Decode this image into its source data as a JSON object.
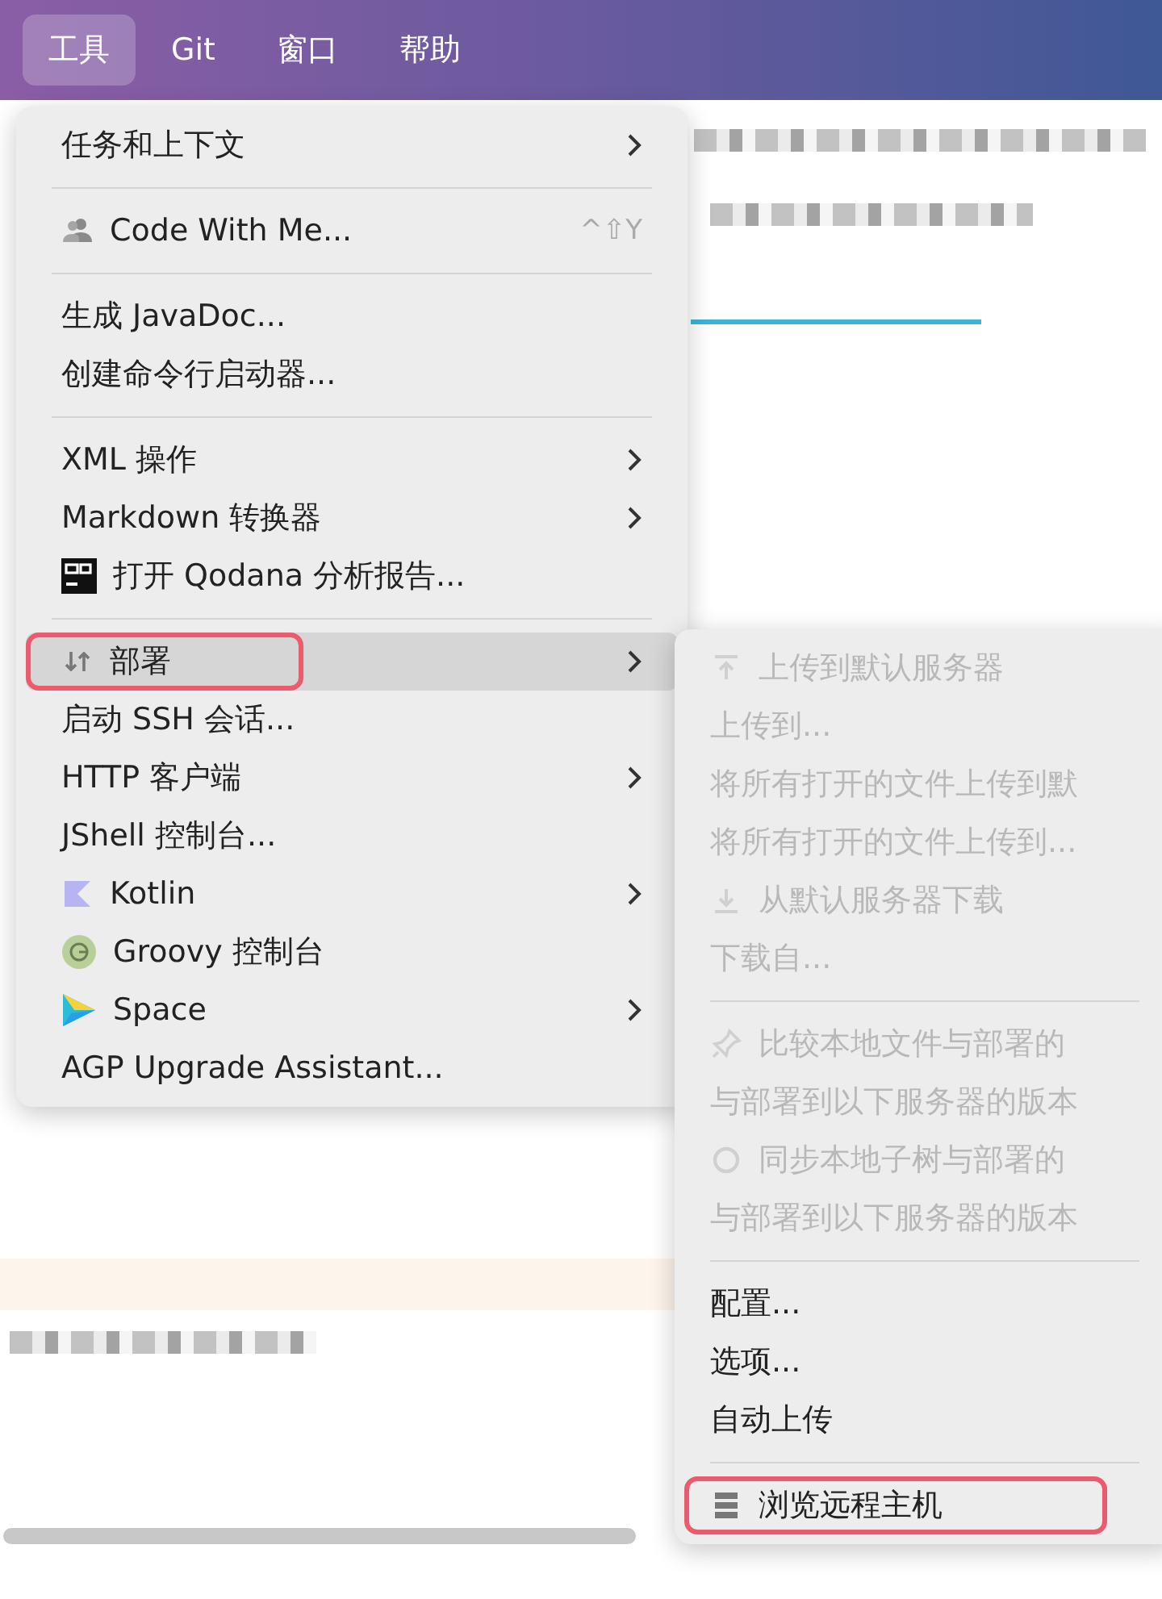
{
  "menubar": [
    {
      "label": "工具",
      "selected": true
    },
    {
      "label": "Git",
      "selected": false
    },
    {
      "label": "窗口",
      "selected": false
    },
    {
      "label": "帮助",
      "selected": false
    }
  ],
  "menu": {
    "items": [
      {
        "kind": "item",
        "label": "任务和上下文",
        "submenu": true,
        "selected": false,
        "highlighted": false
      },
      {
        "kind": "separator"
      },
      {
        "kind": "item",
        "label": "Code With Me...",
        "shortcut": "^⇧Y",
        "submenu": false,
        "selected": false,
        "highlighted": false
      },
      {
        "kind": "separator"
      },
      {
        "kind": "item",
        "label": "生成 JavaDoc...",
        "submenu": false,
        "selected": false,
        "highlighted": false
      },
      {
        "kind": "item",
        "label": "创建命令行启动器...",
        "submenu": false,
        "selected": false,
        "highlighted": false
      },
      {
        "kind": "separator"
      },
      {
        "kind": "item",
        "label": "XML 操作",
        "submenu": true,
        "selected": false,
        "highlighted": false
      },
      {
        "kind": "item",
        "label": "Markdown 转换器",
        "submenu": true,
        "selected": false,
        "highlighted": false
      },
      {
        "kind": "item",
        "label": "打开 Qodana 分析报告...",
        "submenu": false,
        "selected": false,
        "highlighted": false
      },
      {
        "kind": "separator"
      },
      {
        "kind": "item",
        "label": "部署",
        "submenu": true,
        "selected": true,
        "highlighted": true
      },
      {
        "kind": "item",
        "label": "启动 SSH 会话...",
        "submenu": false,
        "selected": false,
        "highlighted": false
      },
      {
        "kind": "item",
        "label": "HTTP 客户端",
        "submenu": true,
        "selected": false,
        "highlighted": false
      },
      {
        "kind": "item",
        "label": "JShell 控制台...",
        "submenu": false,
        "selected": false,
        "highlighted": false
      },
      {
        "kind": "item",
        "label": "Kotlin",
        "submenu": true,
        "selected": false,
        "highlighted": false
      },
      {
        "kind": "item",
        "label": "Groovy 控制台",
        "submenu": false,
        "selected": false,
        "highlighted": false
      },
      {
        "kind": "item",
        "label": "Space",
        "submenu": true,
        "selected": false,
        "highlighted": false
      },
      {
        "kind": "item",
        "label": "AGP Upgrade Assistant...",
        "submenu": false,
        "selected": false,
        "highlighted": false
      }
    ]
  },
  "submenu": {
    "items": [
      {
        "kind": "item",
        "label": "上传到默认服务器",
        "disabled": true,
        "highlighted": false
      },
      {
        "kind": "item",
        "label": "上传到...",
        "disabled": true,
        "highlighted": false
      },
      {
        "kind": "item",
        "label": "将所有打开的文件上传到默",
        "disabled": true,
        "highlighted": false
      },
      {
        "kind": "item",
        "label": "将所有打开的文件上传到...",
        "disabled": true,
        "highlighted": false
      },
      {
        "kind": "item",
        "label": "从默认服务器下载",
        "disabled": true,
        "highlighted": false
      },
      {
        "kind": "item",
        "label": "下载自...",
        "disabled": true,
        "highlighted": false
      },
      {
        "kind": "separator"
      },
      {
        "kind": "item",
        "label": "比较本地文件与部署的",
        "disabled": true,
        "highlighted": false
      },
      {
        "kind": "item",
        "label": "与部署到以下服务器的版本",
        "disabled": true,
        "highlighted": false
      },
      {
        "kind": "item",
        "label": "同步本地子树与部署的",
        "disabled": true,
        "highlighted": false
      },
      {
        "kind": "item",
        "label": "与部署到以下服务器的版本",
        "disabled": true,
        "highlighted": false
      },
      {
        "kind": "separator"
      },
      {
        "kind": "item",
        "label": "配置...",
        "disabled": false,
        "highlighted": false
      },
      {
        "kind": "item",
        "label": "选项...",
        "disabled": false,
        "highlighted": false
      },
      {
        "kind": "item",
        "label": "自动上传",
        "disabled": false,
        "highlighted": false
      },
      {
        "kind": "separator"
      },
      {
        "kind": "item",
        "label": "浏览远程主机",
        "disabled": false,
        "highlighted": true
      }
    ]
  }
}
